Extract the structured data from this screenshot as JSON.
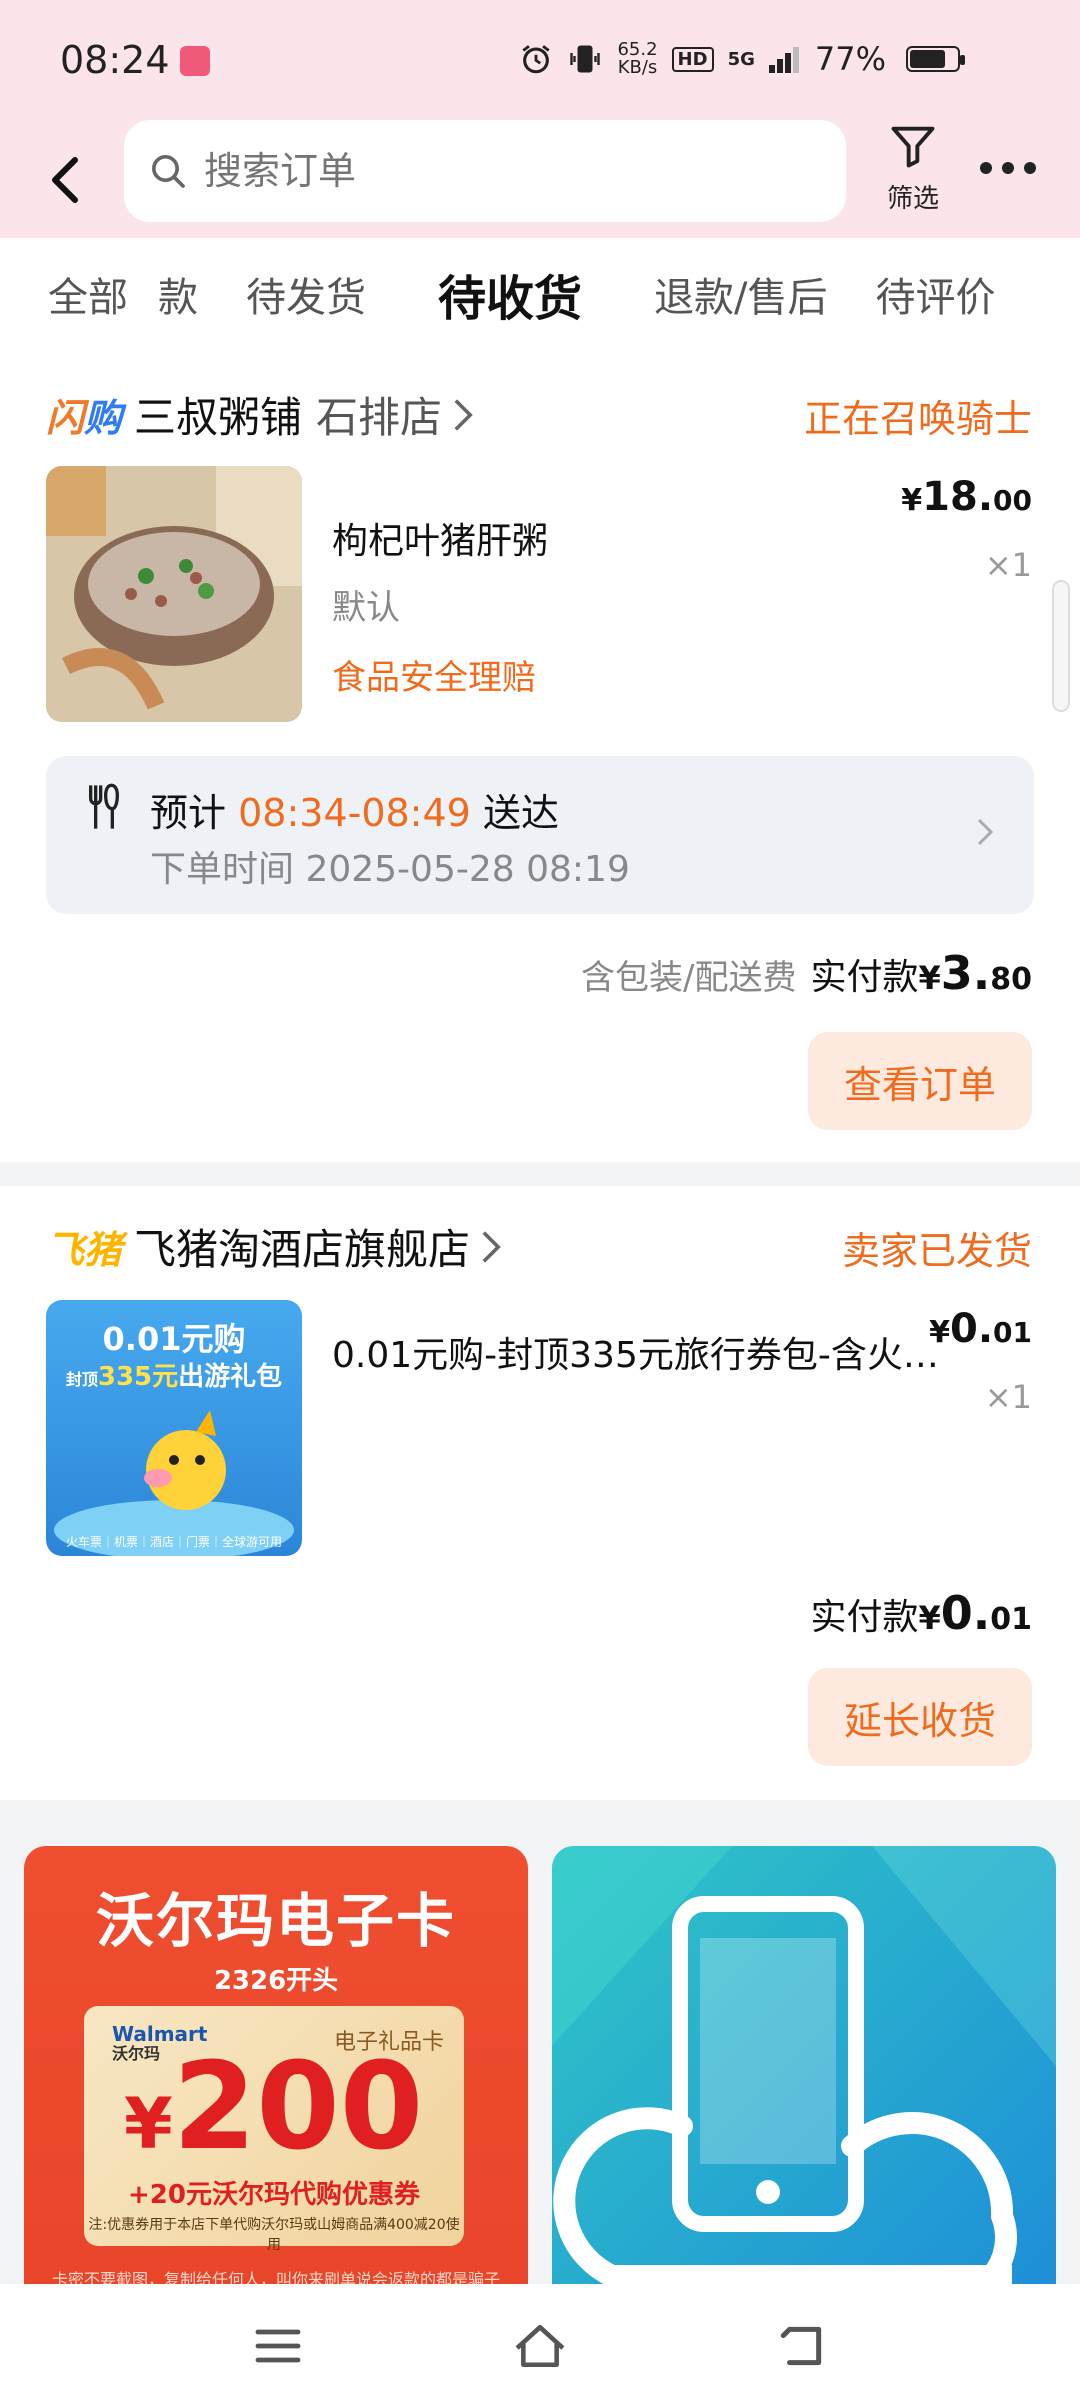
{
  "status_bar": {
    "time": "08:24",
    "speed_value": "65.2",
    "speed_unit": "KB/s",
    "hd": "HD",
    "network": "5G",
    "battery": "77%",
    "battery_level": 0.77
  },
  "search": {
    "placeholder": "搜索订单"
  },
  "toolbar": {
    "filter_label": "筛选"
  },
  "tabs": [
    {
      "label": "全部"
    },
    {
      "label": "款"
    },
    {
      "label": "待发货"
    },
    {
      "label": "待收货"
    },
    {
      "label": "退款/售后"
    },
    {
      "label": "待评价"
    }
  ],
  "orders": [
    {
      "tag": "闪购",
      "shop_name": "三叔粥铺",
      "shop_branch": "石排店",
      "status": "正在召唤骑士",
      "item_name": "枸杞叶猪肝粥",
      "item_spec": "默认",
      "item_link": "食品安全理赔",
      "price_currency": "¥",
      "price_int": "18.",
      "price_dec": "00",
      "qty": "×1",
      "delivery_prefix": "预计",
      "delivery_time": "08:34-08:49",
      "delivery_suffix": "送达",
      "order_time": "下单时间 2025-05-28 08:19",
      "fee_note": "含包装/配送费",
      "paid_label": "实付款",
      "paid_currency": "¥",
      "paid_int": "3.",
      "paid_dec": "80",
      "button": "查看订单"
    },
    {
      "tag": "飞猪",
      "shop_name": "飞猪淘酒店旗舰店",
      "status": "卖家已发货",
      "item_name": "0.01元购-封顶335元旅行券包-含火…",
      "price_currency": "¥",
      "price_int": "0.",
      "price_dec": "01",
      "qty": "×1",
      "thumb_title": "0.01元购",
      "thumb_sub_a": "封顶",
      "thumb_sub_b": "335元",
      "thumb_sub_c": "出游礼包",
      "thumb_footer": "火车票｜机票｜酒店｜门票｜全球游可用",
      "paid_label": "实付款",
      "paid_currency": "¥",
      "paid_int": "0.",
      "paid_dec": "01",
      "button": "延长收货"
    }
  ],
  "ads": {
    "walmart": {
      "title": "沃尔玛电子卡",
      "subtitle": "2326开头",
      "brand": "Walmart",
      "brand_cn": "沃尔玛",
      "gift_label": "电子礼品卡",
      "amount_currency": "¥",
      "amount": "200",
      "coupon": "+20元沃尔玛代购优惠券",
      "fine_print": "注:优惠券用于本店下单代购沃尔玛或山姆商品满400减20使用",
      "warning": "卡密不要截图，复制给任何人，叫你来刷单说会返款的都是骗子"
    }
  },
  "colors": {
    "accent": "#f06b1e",
    "header_bg": "#fbe4ea",
    "button_bg": "#fde9dd",
    "shangou_orange": "#f07a2a",
    "shangou_blue": "#2f7cf6",
    "fliggy_yellow": "#ffb400"
  },
  "icons": [
    "back-icon",
    "search-icon",
    "filter-icon",
    "more-icon",
    "chevron-right-icon",
    "cutlery-icon",
    "menu-icon",
    "home-icon",
    "return-icon"
  ]
}
